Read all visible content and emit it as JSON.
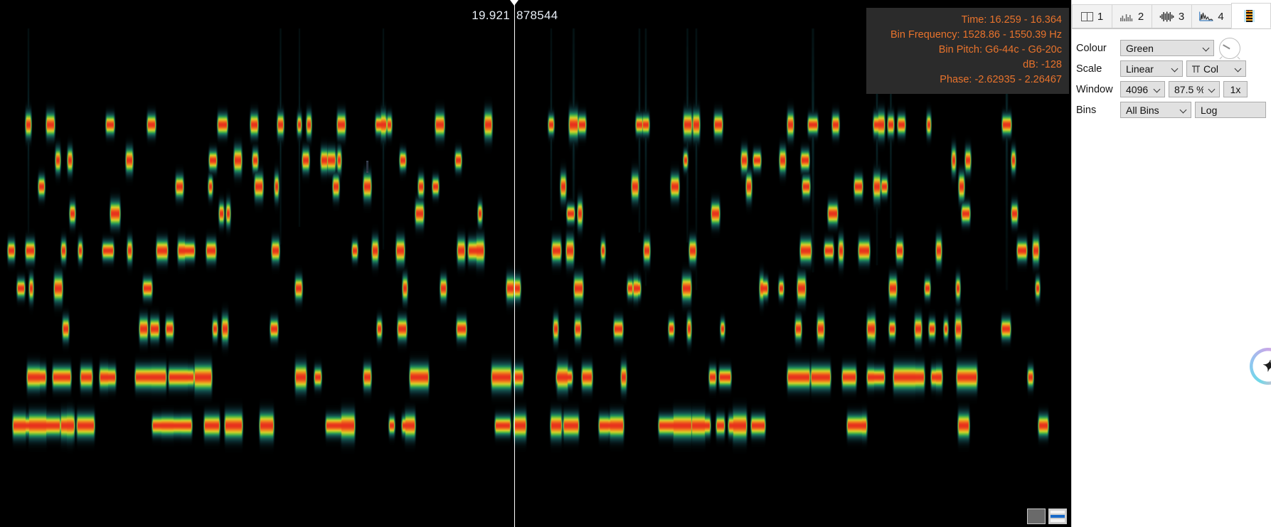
{
  "spectrogram": {
    "time_readout_left": "19.921",
    "time_readout_right": "878544",
    "background_color": "#000000",
    "playhead_color": "#ffffff",
    "colormap": [
      "#000000",
      "#0b2b2f",
      "#14554f",
      "#1f8f5a",
      "#6fc13a",
      "#d6d12a",
      "#f08a1c",
      "#e8321c"
    ]
  },
  "tooltip": {
    "time": "Time: 16.259 - 16.364",
    "bin_frequency": "Bin Frequency: 1528.86 - 1550.39 Hz",
    "bin_pitch": "Bin Pitch: G6-44c - G6-20c",
    "db": "dB: -128",
    "phase": "Phase: -2.62935 - 2.26467",
    "text_color": "#e8732c",
    "background_color": "#2b2b2b"
  },
  "tabs": [
    {
      "label": "1",
      "icon": "split-pane-icon",
      "active": false
    },
    {
      "label": "2",
      "icon": "bar-spectrum-icon",
      "active": false
    },
    {
      "label": "3",
      "icon": "waveform-icon",
      "active": false
    },
    {
      "label": "4",
      "icon": "spectrum-curve-icon",
      "active": false
    },
    {
      "label": "",
      "icon": "spectrogram-icon",
      "active": true
    }
  ],
  "controls": {
    "colour": {
      "label": "Colour",
      "value": "Green"
    },
    "scale": {
      "label": "Scale",
      "value": "Linear",
      "orientation": "Col"
    },
    "window": {
      "label": "Window",
      "size": "4096",
      "overlap": "87.5 %",
      "multiplier": "1x"
    },
    "bins": {
      "label": "Bins",
      "value": "All Bins",
      "scale": "Log"
    }
  },
  "corner_buttons": {
    "pan_button": "pan-tool",
    "scroll_button": "scrollbar-toggle"
  },
  "assistant": {
    "glyph": "✦"
  }
}
